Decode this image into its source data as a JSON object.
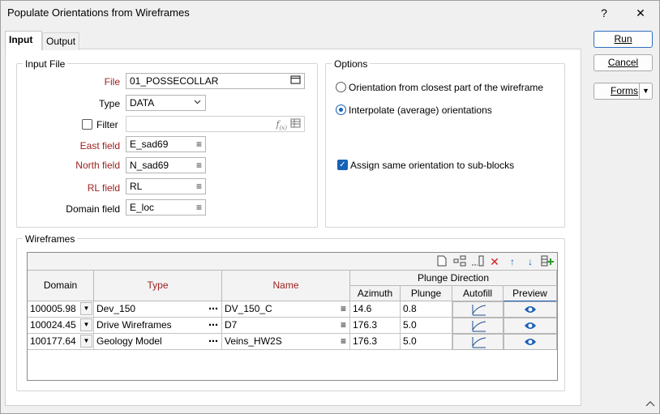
{
  "window": {
    "title": "Populate Orientations from Wireframes",
    "help_label": "?",
    "close_label": "✕"
  },
  "tabs": [
    {
      "label": "Input",
      "active": true
    },
    {
      "label": "Output",
      "active": false
    }
  ],
  "actions": {
    "run": "Run",
    "cancel": "Cancel",
    "forms": "Forms"
  },
  "input_file": {
    "group_label": "Input File",
    "file_label": "File",
    "file_value": "01_POSSECOLLAR",
    "type_label": "Type",
    "type_value": "DATA",
    "filter_label": "Filter",
    "filter_checked": false,
    "filter_value": "",
    "east_label": "East field",
    "east_value": "E_sad69",
    "north_label": "North field",
    "north_value": "N_sad69",
    "rl_label": "RL field",
    "rl_value": "RL",
    "domain_label": "Domain field",
    "domain_value": "E_loc"
  },
  "options": {
    "group_label": "Options",
    "radio_closest": "Orientation from closest part of the wireframe",
    "radio_interpolate": "Interpolate (average) orientations",
    "selected": "interpolate",
    "checkbox_subblocks": "Assign same orientation to sub-blocks",
    "subblocks_checked": true
  },
  "wireframes": {
    "group_label": "Wireframes",
    "columns": {
      "domain": "Domain",
      "type": "Type",
      "name": "Name",
      "plunge_direction": "Plunge Direction",
      "azimuth": "Azimuth",
      "plunge": "Plunge",
      "autofill": "Autofill",
      "preview": "Preview"
    },
    "rows": [
      {
        "domain": "100005.98",
        "type": "Dev_150",
        "name": "DV_150_C",
        "azimuth": "14.6",
        "plunge": "0.8"
      },
      {
        "domain": "100024.45",
        "type": "Drive Wireframes",
        "name": "D7",
        "azimuth": "176.3",
        "plunge": "5.0"
      },
      {
        "domain": "100177.64",
        "type": "Geology Model",
        "name": "Veins_HW2S",
        "azimuth": "176.3",
        "plunge": "5.0"
      }
    ]
  },
  "colors": {
    "required_label": "#9c1c1c",
    "accent": "#1662b8"
  }
}
